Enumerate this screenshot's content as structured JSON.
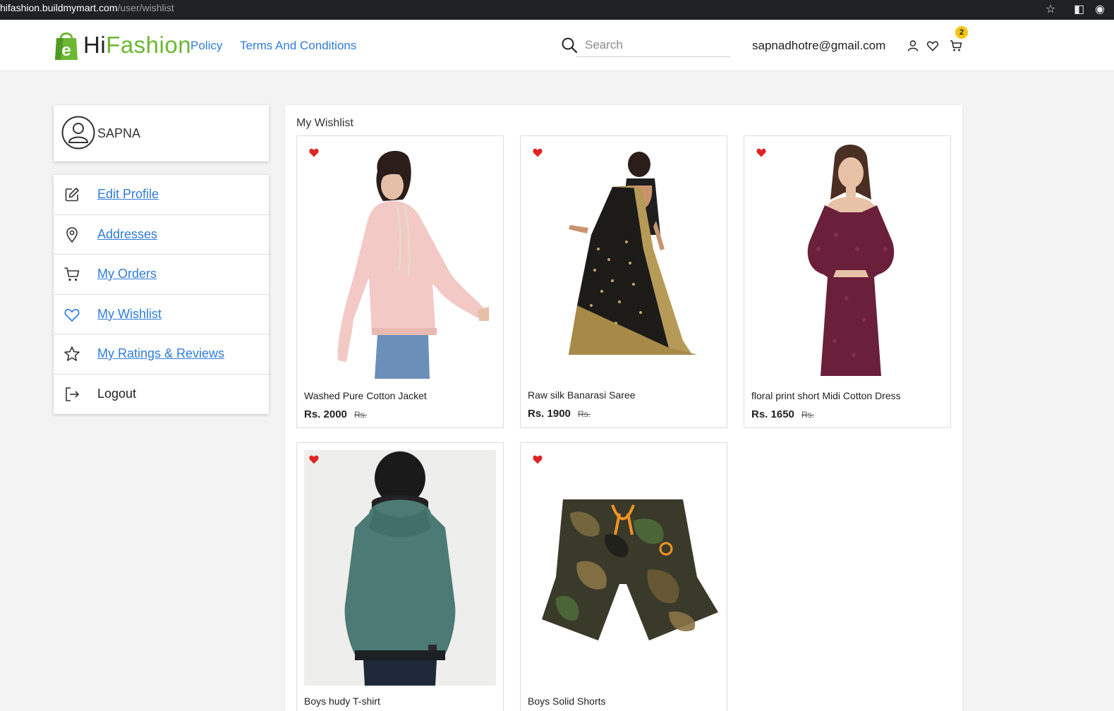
{
  "browser": {
    "url_host": "hifashion.buildmymart.com",
    "url_path": "/user/wishlist"
  },
  "header": {
    "brand_hi": "Hi",
    "brand_fashion": "Fashion",
    "logo_letter": "e",
    "nav": {
      "policy": "Policy",
      "terms": "Terms And Conditions"
    },
    "search_placeholder": "Search",
    "user_email": "sapnadhotre@gmail.com",
    "cart_count": "2",
    "colors": {
      "brand_green": "#6cb832",
      "link_blue": "#2f7cd9",
      "badge_yellow": "#f5c518"
    }
  },
  "sidebar": {
    "profile_name": "SAPNA",
    "items": [
      {
        "label": "Edit Profile",
        "icon": "edit-icon"
      },
      {
        "label": "Addresses",
        "icon": "location-pin-icon"
      },
      {
        "label": "My Orders",
        "icon": "cart-icon"
      },
      {
        "label": "My Wishlist",
        "icon": "heart-icon"
      },
      {
        "label": "My Ratings & Reviews",
        "icon": "star-icon"
      },
      {
        "label": "Logout",
        "icon": "logout-icon"
      }
    ]
  },
  "wishlist": {
    "title": "My Wishlist",
    "products": [
      {
        "name": "Washed Pure Cotton Jacket",
        "price": "Rs. 2000",
        "old_price": "Rs."
      },
      {
        "name": "Raw silk Banarasi Saree",
        "price": "Rs. 1900",
        "old_price": "Rs."
      },
      {
        "name": "floral print short Midi Cotton Dress",
        "price": "Rs. 1650",
        "old_price": "Rs."
      },
      {
        "name": "Boys hudy T-shirt"
      },
      {
        "name": "Boys Solid Shorts"
      }
    ]
  }
}
